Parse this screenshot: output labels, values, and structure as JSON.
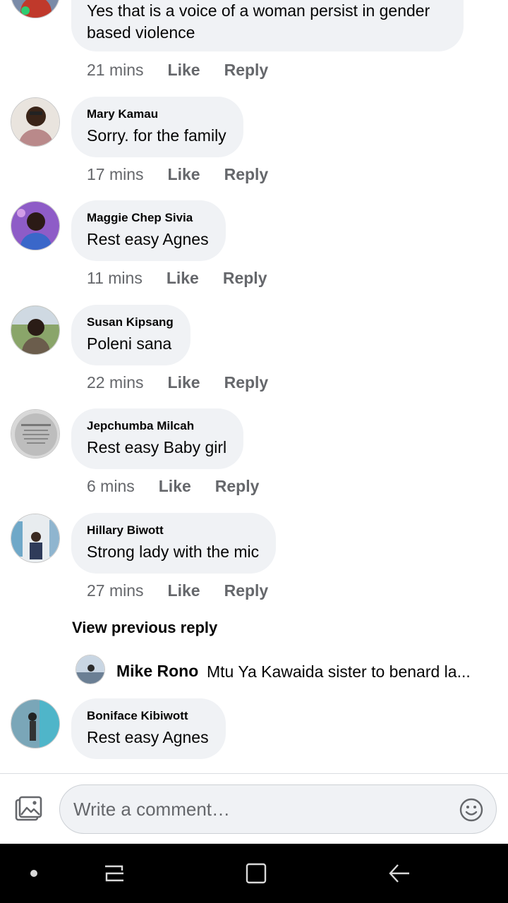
{
  "comments": [
    {
      "author": "",
      "text": "Yes that is a voice of a woman persist in gender",
      "text2": "based violence",
      "time": "21 mins"
    },
    {
      "author": "Mary Kamau",
      "text": "Sorry. for the family",
      "time": "17 mins"
    },
    {
      "author": "Maggie Chep Sivia",
      "text": "Rest easy Agnes",
      "time": "11 mins"
    },
    {
      "author": "Susan Kipsang",
      "text": "Poleni sana",
      "time": "22 mins"
    },
    {
      "author": "Jepchumba Milcah",
      "text": "Rest easy Baby girl",
      "time": "6 mins"
    },
    {
      "author": "Hillary Biwott",
      "text": "Strong lady with the mic",
      "time": "27 mins"
    },
    {
      "author": "Boniface Kibiwott",
      "text": "Rest easy Agnes",
      "time": ""
    }
  ],
  "actions": {
    "like": "Like",
    "reply": "Reply"
  },
  "view_previous": "View previous reply",
  "reply_preview": {
    "author": "Mike Rono",
    "text": "Mtu Ya Kawaida sister to benard la..."
  },
  "composer": {
    "placeholder": "Write a comment…",
    "photo_icon": "photo-icon",
    "emoji_icon": "smiley-icon"
  },
  "colors": {
    "bubble": "#f0f2f5",
    "meta": "#65676b",
    "navbar": "#000000"
  }
}
